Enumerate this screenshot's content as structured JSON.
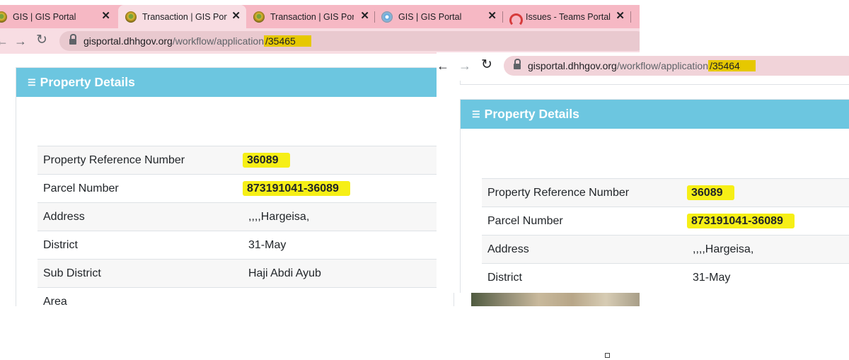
{
  "left": {
    "tabs": [
      {
        "label": "GIS | GIS Portal",
        "icon": "seal-icon",
        "active": false
      },
      {
        "label": "Transaction | GIS Portal",
        "icon": "seal-icon",
        "active": true
      },
      {
        "label": "Transaction | GIS Portal",
        "icon": "seal-icon",
        "active": false
      },
      {
        "label": "GIS | GIS Portal",
        "icon": "globe-icon",
        "active": false
      },
      {
        "label": "Issues - Teams Portal",
        "icon": "teams-icon",
        "active": false
      }
    ],
    "close_glyph": "✕",
    "url_host": "gisportal.dhhgov.org",
    "url_path": "/workflow/application",
    "url_id": "/35465",
    "panel_title": "Property Details",
    "rows": [
      {
        "label": "Property Reference Number",
        "value": "36089",
        "highlight": true
      },
      {
        "label": "Parcel Number",
        "value": "873191041-36089",
        "highlight": true
      },
      {
        "label": "Address",
        "value": ",,,,Hargeisa,",
        "highlight": false
      },
      {
        "label": "District",
        "value": "31-May",
        "highlight": false
      },
      {
        "label": "Sub District",
        "value": "Haji Abdi Ayub",
        "highlight": false
      },
      {
        "label": "Area",
        "value": "",
        "highlight": false
      }
    ]
  },
  "right": {
    "url_host": "gisportal.dhhgov.org",
    "url_path": "/workflow/application",
    "url_id": "/35464",
    "panel_title": "Property Details",
    "rows": [
      {
        "label": "Property Reference Number",
        "value": "36089",
        "highlight": true
      },
      {
        "label": "Parcel Number",
        "value": "873191041-36089",
        "highlight": true
      },
      {
        "label": "Address",
        "value": ",,,,Hargeisa,",
        "highlight": false
      },
      {
        "label": "District",
        "value": "31-May",
        "highlight": false
      }
    ]
  },
  "icons": {
    "back": "back-arrow-icon",
    "forward": "forward-arrow-icon",
    "reload": "reload-icon",
    "lock": "lock-icon",
    "list": "list-icon"
  },
  "colors": {
    "panel_header": "#6cc6e0",
    "tab_bar": "#f6b8c4",
    "highlight": "#f6ef16"
  }
}
